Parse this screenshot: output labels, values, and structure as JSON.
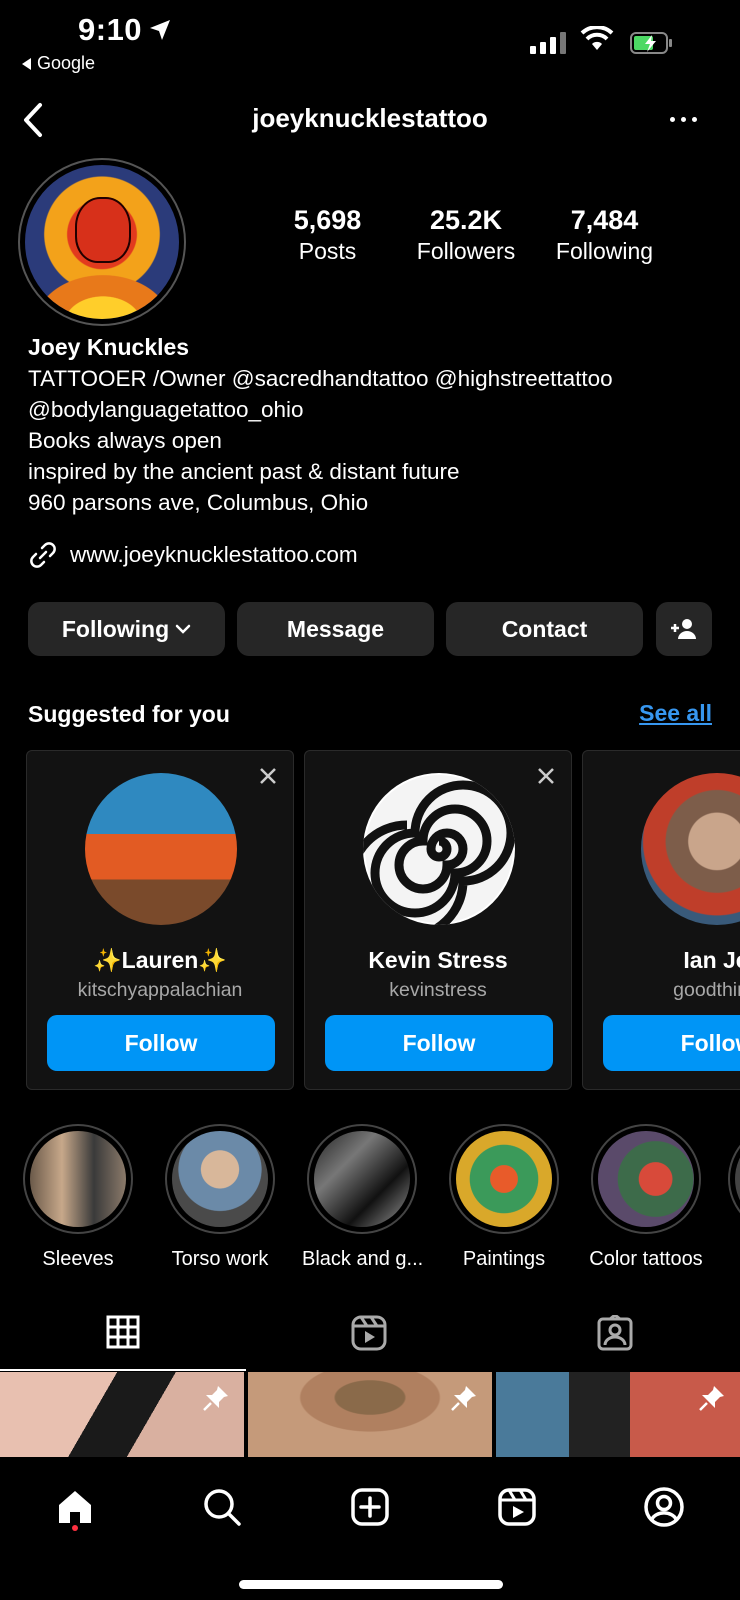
{
  "status_bar": {
    "time": "9:10",
    "back_app": "Google"
  },
  "header": {
    "username": "joeyknucklestattoo"
  },
  "profile": {
    "stats": [
      {
        "value": "5,698",
        "label": "Posts"
      },
      {
        "value": "25.2K",
        "label": "Followers"
      },
      {
        "value": "7,484",
        "label": "Following"
      }
    ],
    "name": "Joey Knuckles",
    "bio_lines": [
      "TATTOOER /Owner @sacredhandtattoo @highstreettattoo",
      "@bodylanguagetattoo_ohio",
      "Books always open",
      "inspired by the ancient past & distant future",
      "960 parsons ave, Columbus, Ohio"
    ],
    "website": "www.joeyknucklestattoo.com"
  },
  "actions": {
    "following": "Following",
    "message": "Message",
    "contact": "Contact"
  },
  "suggested": {
    "title": "Suggested for you",
    "see_all": "See all",
    "cards": [
      {
        "name": "✨Lauren✨",
        "handle": "kitschyappalachian",
        "button": "Follow"
      },
      {
        "name": "Kevin Stress",
        "handle": "kevinstress",
        "button": "Follow"
      },
      {
        "name": "Ian Je",
        "handle": "goodthing",
        "button": "Follow"
      }
    ]
  },
  "highlights": [
    {
      "label": "Sleeves"
    },
    {
      "label": "Torso work"
    },
    {
      "label": "Black and g..."
    },
    {
      "label": "Paintings"
    },
    {
      "label": "Color tattoos"
    }
  ]
}
